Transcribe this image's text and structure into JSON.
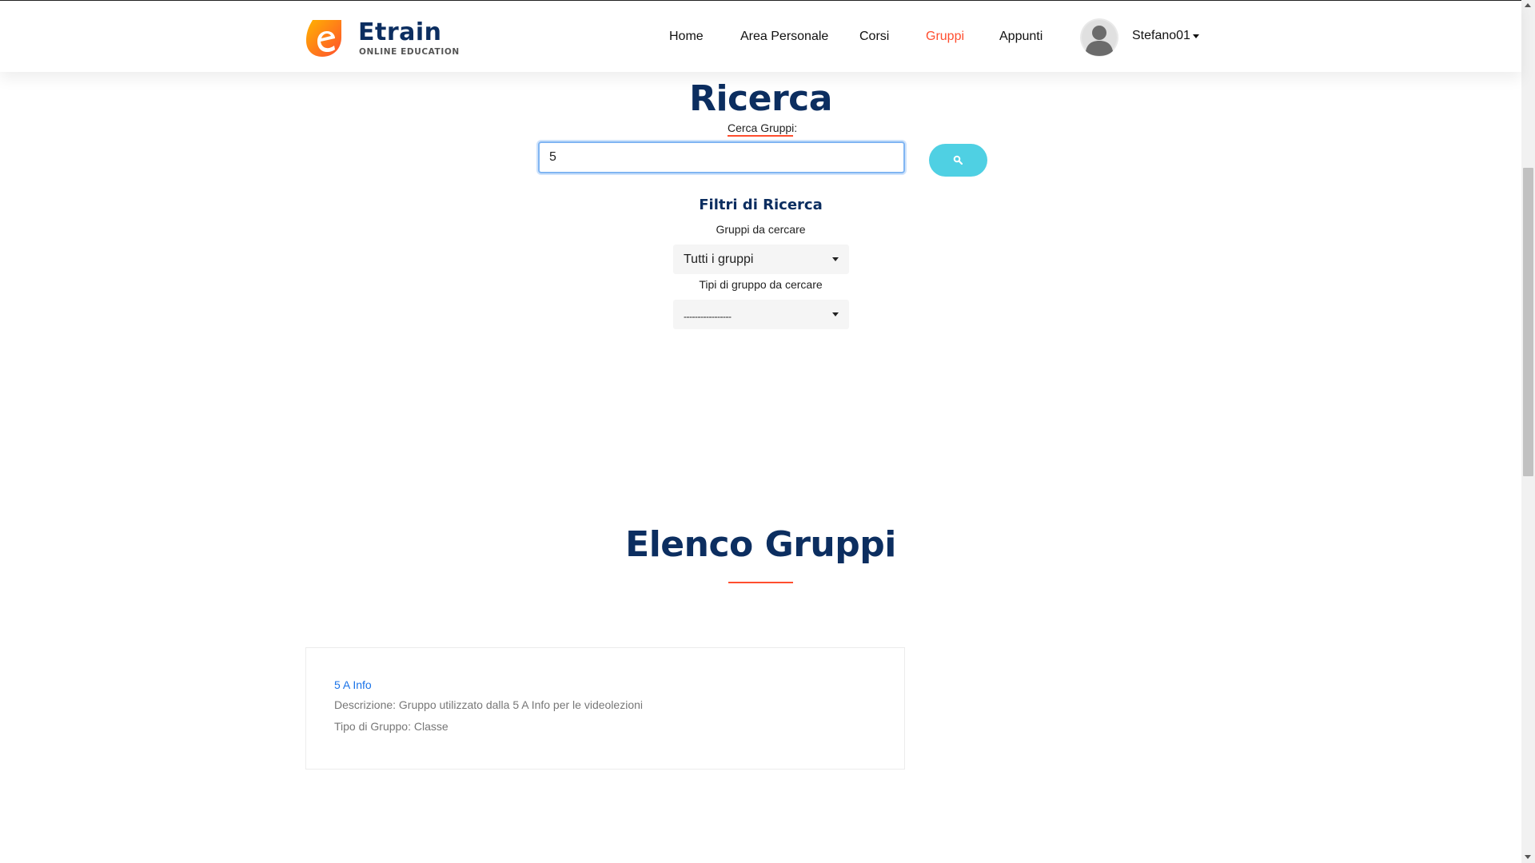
{
  "header": {
    "logo_title": "Etrain",
    "logo_subtitle": "ONLINE EDUCATION",
    "nav": [
      {
        "label": "Home",
        "active": false
      },
      {
        "label": "Area Personale",
        "active": false
      },
      {
        "label": "Corsi",
        "active": false
      },
      {
        "label": "Gruppi",
        "active": true
      },
      {
        "label": "Appunti",
        "active": false
      }
    ],
    "username": "Stefano01"
  },
  "search": {
    "title": "Ricerca",
    "label": "Cerca Gruppi:",
    "value": "5",
    "button_icon": "search-icon"
  },
  "filters": {
    "title": "Filtri di Ricerca",
    "groups_label": "Gruppi da cercare",
    "groups_selected": "Tutti i gruppi",
    "types_label": "Tipi di gruppo da cercare",
    "types_selected": "-----------------"
  },
  "list": {
    "title": "Elenco Gruppi",
    "items": [
      {
        "name": "5 A Info",
        "description": "Descrizione: Gruppo utilizzato dalla 5 A Info per le videolezioni",
        "type": "Tipo di Gruppo: Classe"
      }
    ]
  },
  "colors": {
    "brand_navy": "#0c2e60",
    "accent_orange": "#ff4e2f",
    "button_cyan": "#4fd0e3",
    "link_blue": "#1a73e8"
  }
}
